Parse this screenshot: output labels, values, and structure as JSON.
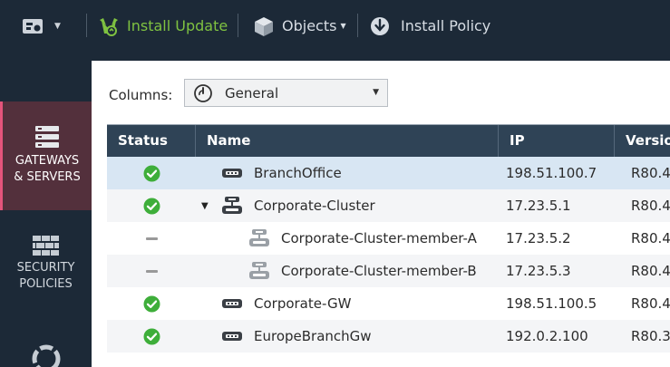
{
  "toolbar": {
    "install_update": "Install Update",
    "objects": "Objects",
    "install_policy": "Install Policy",
    "colors": {
      "bg": "#1c2937",
      "accent_green": "#7fc241"
    }
  },
  "sidebar": {
    "items": [
      {
        "label_line1": "GATEWAYS",
        "label_line2": "& SERVERS",
        "icon": "gateways-servers-icon",
        "active": true
      },
      {
        "label_line1": "SECURITY",
        "label_line2": "POLICIES",
        "icon": "security-policies-icon",
        "active": false
      },
      {
        "icon": "logs-monitor-icon",
        "active": false
      }
    ],
    "active_color": "#e4547b"
  },
  "columns": {
    "label": "Columns:",
    "selected": "General"
  },
  "table": {
    "headers": [
      "Status",
      "Name",
      "IP",
      "Versio"
    ],
    "rows": [
      {
        "status": "ok",
        "name": "BranchOffice",
        "ip": "198.51.100.7",
        "version": "R80.4",
        "icon": "gateway-icon",
        "indent": 0,
        "selected": true
      },
      {
        "status": "ok",
        "name": "Corporate-Cluster",
        "ip": "17.23.5.1",
        "version": "R80.4",
        "icon": "cluster-icon",
        "indent": 0,
        "expanded": true
      },
      {
        "status": "none",
        "name": "Corporate-Cluster-member-A",
        "ip": "17.23.5.2",
        "version": "R80.4",
        "icon": "cluster-member-icon",
        "indent": 1
      },
      {
        "status": "none",
        "name": "Corporate-Cluster-member-B",
        "ip": "17.23.5.3",
        "version": "R80.4",
        "icon": "cluster-member-icon",
        "indent": 1
      },
      {
        "status": "ok",
        "name": "Corporate-GW",
        "ip": "198.51.100.5",
        "version": "R80.4",
        "icon": "gateway-icon",
        "indent": 0
      },
      {
        "status": "ok",
        "name": "EuropeBranchGw",
        "ip": "192.0.2.100",
        "version": "R80.3",
        "icon": "gateway-icon",
        "indent": 0
      }
    ]
  }
}
